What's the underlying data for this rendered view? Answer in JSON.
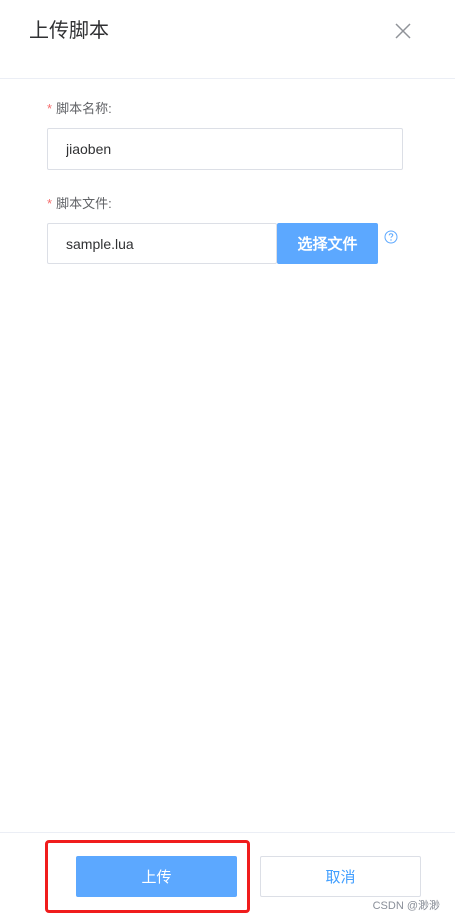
{
  "dialog": {
    "title": "上传脚本",
    "close_icon": "close-icon"
  },
  "form": {
    "required_mark": "*",
    "name_field": {
      "label": "脚本名称:",
      "value": "jiaoben"
    },
    "file_field": {
      "label": "脚本文件:",
      "value": "sample.lua",
      "choose_button": "选择文件",
      "help_icon": "question-circle-icon"
    }
  },
  "footer": {
    "upload_button": "上传",
    "cancel_button": "取消"
  },
  "watermark": "CSDN @渺渺",
  "colors": {
    "primary": "#5ca8ff",
    "link": "#409eff",
    "required": "#f56c6c",
    "highlight": "#f01c1c"
  }
}
